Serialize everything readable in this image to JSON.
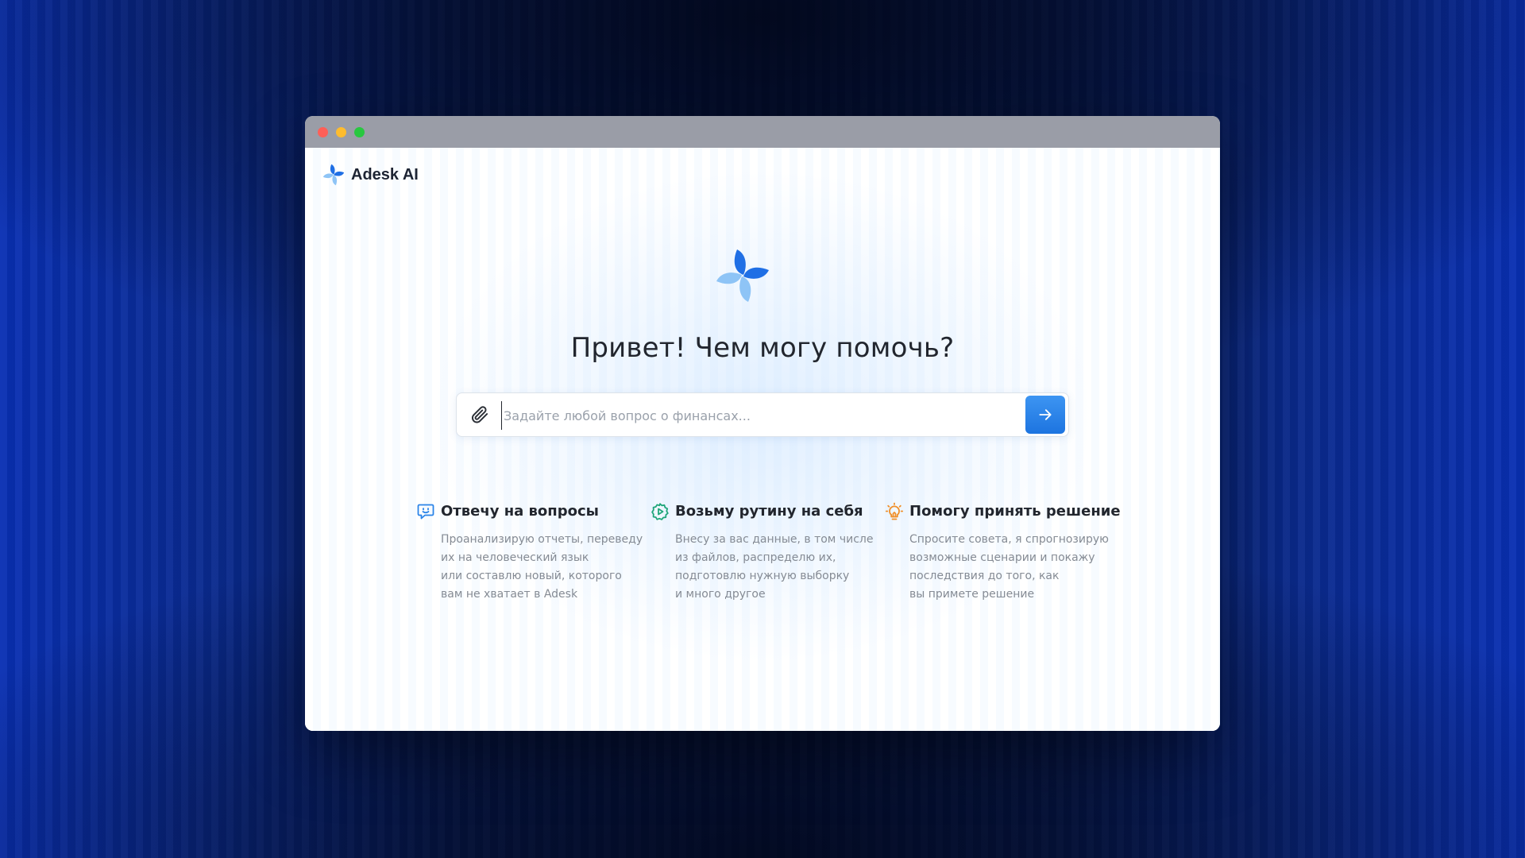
{
  "app": {
    "brand_name": "Adesk AI",
    "greeting": "Привет! Чем могу помочь?"
  },
  "chat_input": {
    "placeholder": "Задайте любой вопрос о финансах...",
    "value": "",
    "attach_icon": "paperclip-icon",
    "send_icon": "arrow-right-icon"
  },
  "features": [
    {
      "icon": "chat-smile-icon",
      "title": "Отвечу на вопросы",
      "lines": [
        "Проанализирую отчеты, переведу",
        "их на человеческий язык",
        "или составлю новый, которого",
        "вам не хватает в Adesk"
      ]
    },
    {
      "icon": "gear-play-icon",
      "title": "Возьму рутину на себя",
      "lines": [
        "Внесу за вас данные, в том числе",
        "из файлов, распределю их,",
        "подготовлю нужную выборку",
        "и много другое"
      ]
    },
    {
      "icon": "lightbulb-icon",
      "title": "Помогу принять решение",
      "lines": [
        "Спросите совета, я спрогнозирую",
        "возможные сценарии и покажу",
        "последствия до того, как",
        "вы примете решение"
      ]
    }
  ],
  "colors": {
    "accent": "#1d74e0",
    "logo_dark": "#1f6fe5",
    "logo_light": "#8ec4f6",
    "feature_1_icon": "#2b84e8",
    "feature_2_icon": "#1fa67a",
    "feature_3_icon": "#f0902a"
  }
}
